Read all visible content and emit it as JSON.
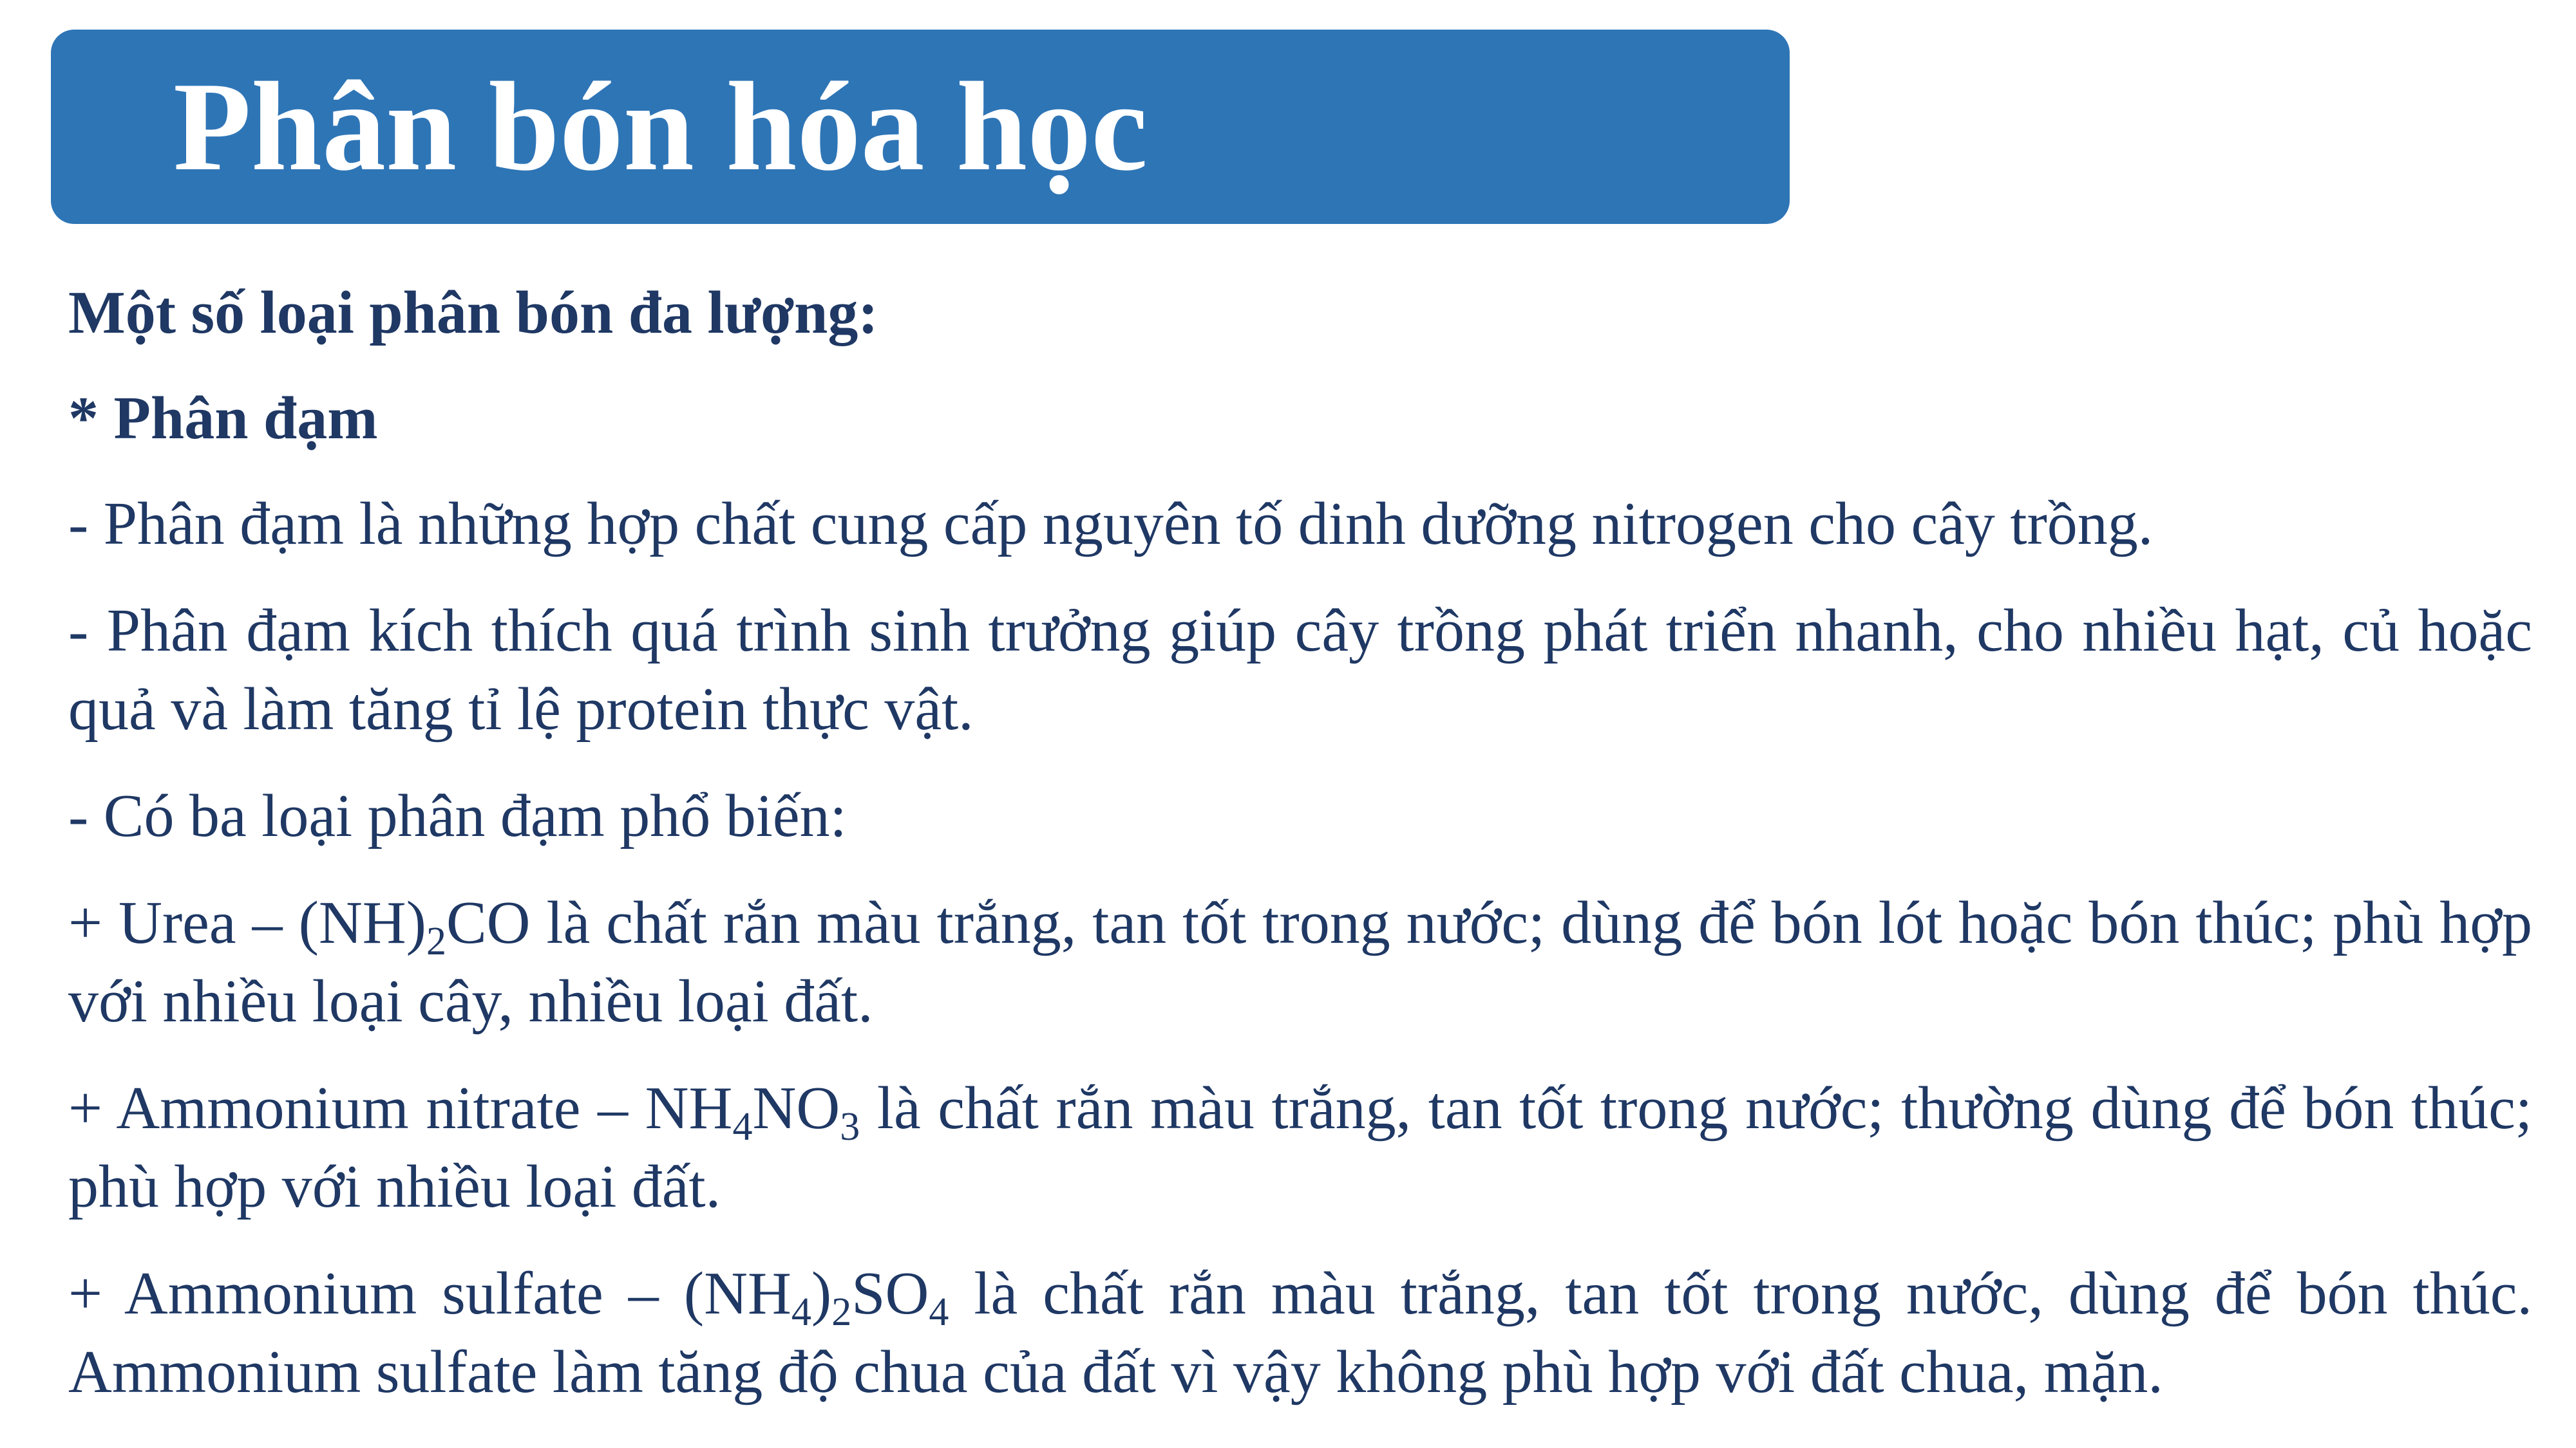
{
  "title": "Phân bón hóa học",
  "content": {
    "heading_1": "Một số loại phân bón đa lượng:",
    "heading_2": "* Phân đạm",
    "line_1": "- Phân đạm là những hợp chất cung cấp nguyên tố dinh dưỡng nitrogen cho cây trồng.",
    "line_2": "- Phân đạm kích thích quá trình sinh trưởng giúp cây trồng phát triển nhanh, cho nhiều hạt, củ hoặc quả và làm tăng tỉ lệ protein thực vật.",
    "line_3": "- Có ba loại phân đạm phổ biến:",
    "urea": {
      "prefix": "+ Urea – (NH)",
      "sub_1": "2",
      "suffix": "CO là chất rắn màu trắng, tan tốt trong nước; dùng để bón lót hoặc bón thúc; phù hợp với nhiều loại cây, nhiều loại đất."
    },
    "nitrate": {
      "prefix": "+ Ammonium nitrate – NH",
      "sub_1": "4",
      "mid": "NO",
      "sub_2": "3",
      "suffix": " là chất rắn màu trắng, tan tốt trong nước; thường dùng để bón thúc; phù hợp với nhiều loại đất."
    },
    "sulfate": {
      "prefix": "+ Ammonium sulfate – (NH",
      "sub_1": "4",
      "mid_1": ")",
      "sub_2": "2",
      "mid_2": "SO",
      "sub_3": "4",
      "suffix": " là chất rắn màu trắng, tan tốt trong nước, dùng để bón thúc. Ammonium sulfate làm tăng độ chua của đất vì vậy không phù hợp với đất chua, mặn."
    }
  },
  "colors": {
    "title_bar": "#2e75b6",
    "title_text": "#ffffff",
    "body_text": "#1f3864",
    "background": "#ffffff"
  }
}
